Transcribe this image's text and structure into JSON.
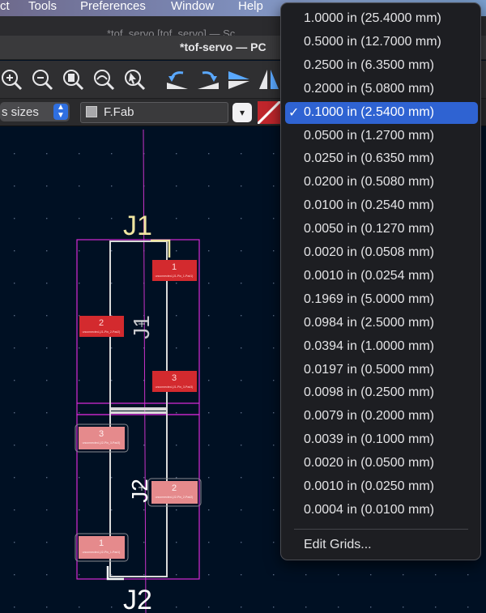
{
  "menubar": {
    "items": [
      "ct",
      "Tools",
      "Preferences",
      "Window",
      "Help"
    ]
  },
  "window": {
    "tab_title": "*tof_servo [tof_servo] — Sc",
    "title": "*tof-servo — PC"
  },
  "toolbar": {
    "icons": [
      "zoom-in-icon",
      "zoom-out-icon",
      "zoom-fit-icon",
      "zoom-objects-icon",
      "zoom-selection-icon",
      "rotate-ccw-icon",
      "rotate-cw-icon",
      "flip-horizontal-icon",
      "mirror-icon"
    ]
  },
  "options": {
    "track_sizes_label": "s sizes",
    "layer_label": "F.Fab",
    "layer_swatch_color": "#a8a8ab"
  },
  "board": {
    "j1_top_label": "J1",
    "j1_body_label": "J1",
    "j2_body_label": "J2",
    "j2_bottom_label": "J2",
    "pads_j1": [
      {
        "num": "1",
        "net": "unconnected-(J1-Pin_1-Pad1)"
      },
      {
        "num": "2",
        "net": "unconnected-(J1-Pin_2-Pad2)"
      },
      {
        "num": "3",
        "net": "unconnected-(J1-Pin_3-Pad3)"
      }
    ],
    "pads_j2": [
      {
        "num": "3",
        "net": "unconnected-(J2-Pin_3-Pad3)"
      },
      {
        "num": "2",
        "net": "unconnected-(J2-Pin_2-Pad2)"
      },
      {
        "num": "1",
        "net": "unconnected-(J2-Pin_1-Pad1)"
      }
    ]
  },
  "grid_menu": {
    "items": [
      "1.0000 in (25.4000 mm)",
      "0.5000 in (12.7000 mm)",
      "0.2500 in (6.3500 mm)",
      "0.2000 in (5.0800 mm)",
      "0.1000 in (2.5400 mm)",
      "0.0500 in (1.2700 mm)",
      "0.0250 in (0.6350 mm)",
      "0.0200 in (0.5080 mm)",
      "0.0100 in (0.2540 mm)",
      "0.0050 in (0.1270 mm)",
      "0.0020 in (0.0508 mm)",
      "0.0010 in (0.0254 mm)",
      "0.1969 in (5.0000 mm)",
      "0.0984 in (2.5000 mm)",
      "0.0394 in (1.0000 mm)",
      "0.0197 in (0.5000 mm)",
      "0.0098 in (0.2500 mm)",
      "0.0079 in (0.2000 mm)",
      "0.0039 in (0.1000 mm)",
      "0.0020 in (0.0500 mm)",
      "0.0010 in (0.0250 mm)",
      "0.0004 in (0.0100 mm)"
    ],
    "selected_index": 4,
    "check_glyph": "✓",
    "edit_label": "Edit Grids..."
  },
  "colors": {
    "canvas_bg": "#001023",
    "selection_blue": "#2f63d2",
    "pad_red": "#d32a2e",
    "pad_pink": "#e58a8c",
    "courtyard_magenta": "#d62ad6",
    "fab_white": "#d9d9d9",
    "silk_yellow": "#f0e6a0"
  }
}
